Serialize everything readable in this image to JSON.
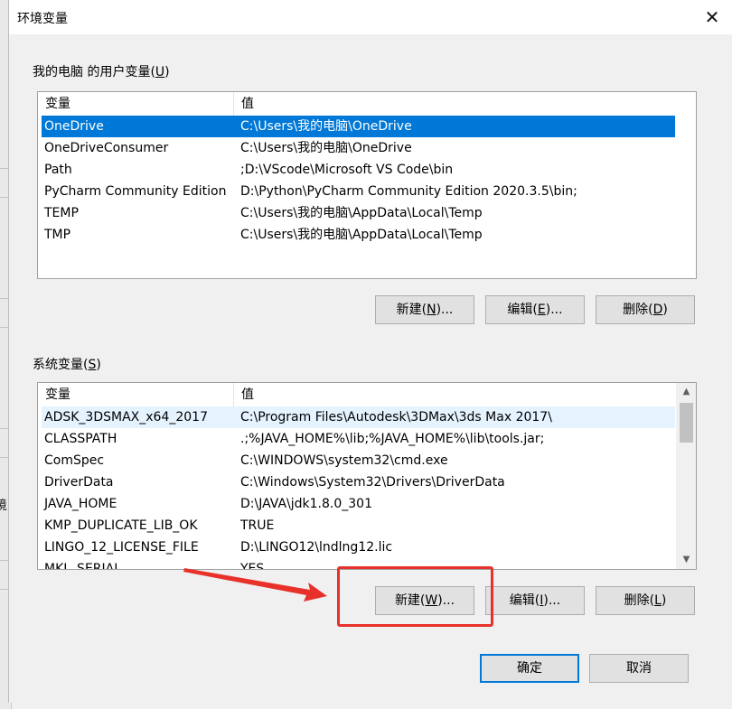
{
  "dialog": {
    "title": "环境变量",
    "close_glyph": "✕"
  },
  "user_vars": {
    "group_label": "我的电脑 的用户变量(",
    "group_accel": "U",
    "group_close": ")",
    "headers": {
      "variable": "变量",
      "value": "值"
    },
    "rows": [
      {
        "variable": "OneDrive",
        "value": "C:\\Users\\我的电脑\\OneDrive"
      },
      {
        "variable": "OneDriveConsumer",
        "value": "C:\\Users\\我的电脑\\OneDrive"
      },
      {
        "variable": "Path",
        "value": ";D:\\VScode\\Microsoft VS Code\\bin"
      },
      {
        "variable": "PyCharm Community Edition",
        "value": "D:\\Python\\PyCharm Community Edition 2020.3.5\\bin;"
      },
      {
        "variable": "TEMP",
        "value": "C:\\Users\\我的电脑\\AppData\\Local\\Temp"
      },
      {
        "variable": "TMP",
        "value": "C:\\Users\\我的电脑\\AppData\\Local\\Temp"
      }
    ],
    "selected_index": 0,
    "buttons": {
      "new": {
        "pre": "新建(",
        "key": "N",
        "post": ")..."
      },
      "edit": {
        "pre": "编辑(",
        "key": "E",
        "post": ")..."
      },
      "delete": {
        "pre": "删除(",
        "key": "D",
        "post": ")"
      }
    }
  },
  "system_vars": {
    "group_label": "系统变量(",
    "group_accel": "S",
    "group_close": ")",
    "headers": {
      "variable": "变量",
      "value": "值"
    },
    "rows": [
      {
        "variable": "ADSK_3DSMAX_x64_2017",
        "value": "C:\\Program Files\\Autodesk\\3DMax\\3ds Max 2017\\"
      },
      {
        "variable": "CLASSPATH",
        "value": " .;%JAVA_HOME%\\lib;%JAVA_HOME%\\lib\\tools.jar;"
      },
      {
        "variable": "ComSpec",
        "value": "C:\\WINDOWS\\system32\\cmd.exe"
      },
      {
        "variable": "DriverData",
        "value": "C:\\Windows\\System32\\Drivers\\DriverData"
      },
      {
        "variable": "JAVA_HOME",
        "value": "D:\\JAVA\\jdk1.8.0_301"
      },
      {
        "variable": "KMP_DUPLICATE_LIB_OK",
        "value": "TRUE"
      },
      {
        "variable": "LINGO_12_LICENSE_FILE",
        "value": "D:\\LINGO12\\lndlng12.lic"
      },
      {
        "variable": "MKL_SERIAL",
        "value": "YES"
      }
    ],
    "hover_index": 0,
    "buttons": {
      "new": {
        "pre": "新建(",
        "key": "W",
        "post": ")..."
      },
      "edit": {
        "pre": "编辑(",
        "key": "I",
        "post": ")..."
      },
      "delete": {
        "pre": "删除(",
        "key": "L",
        "post": ")"
      }
    },
    "scroll": {
      "up_glyph": "▲",
      "down_glyph": "▼"
    }
  },
  "footer": {
    "ok_label": "确定",
    "cancel_label": "取消"
  },
  "bg_window": {
    "glyph": "境"
  },
  "annotation": {
    "color": "#e8312a"
  }
}
